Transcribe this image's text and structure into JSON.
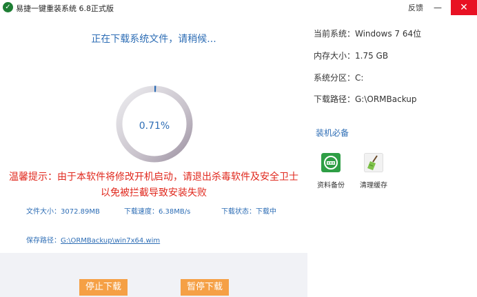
{
  "window": {
    "title": "易捷一键重装系统 6.8正式版",
    "feedback": "反馈",
    "minimize": "—",
    "close": "✕",
    "logo_glyph": "✓"
  },
  "download": {
    "status_title": "正在下载系统文件，请稍候...",
    "progress_text": "0.71%",
    "progress_value": 0.71,
    "warning_line1": "温馨提示：由于本软件将修改开机启动，请退出杀毒软件及安全卫士",
    "warning_line2": "以免被拦截导致安装失败",
    "file_size": "文件大小：3072.89MB",
    "speed": "下载速度：6.38MB/s",
    "state": "下载状态：下载中",
    "save_path_label": "保存路径：",
    "save_path_value": "G:\\ORMBackup\\win7x64.wim",
    "stop_button": "停止下载",
    "pause_button": "暂停下载"
  },
  "system_info": {
    "current_system": "当前系统：Windows 7 64位",
    "memory": "内存大小：1.75 GB",
    "partition": "系统分区：C:",
    "download_path": "下载路径：G:\\ORMBackup"
  },
  "tools": {
    "section_title": "装机必备",
    "items": [
      {
        "label": "资料备份",
        "icon": "backup-icon"
      },
      {
        "label": "清理缓存",
        "icon": "broom-icon"
      }
    ]
  },
  "colors": {
    "accent": "#2d6db5",
    "warning": "#e0281d",
    "button": "#f5a045",
    "close": "#e81123"
  }
}
